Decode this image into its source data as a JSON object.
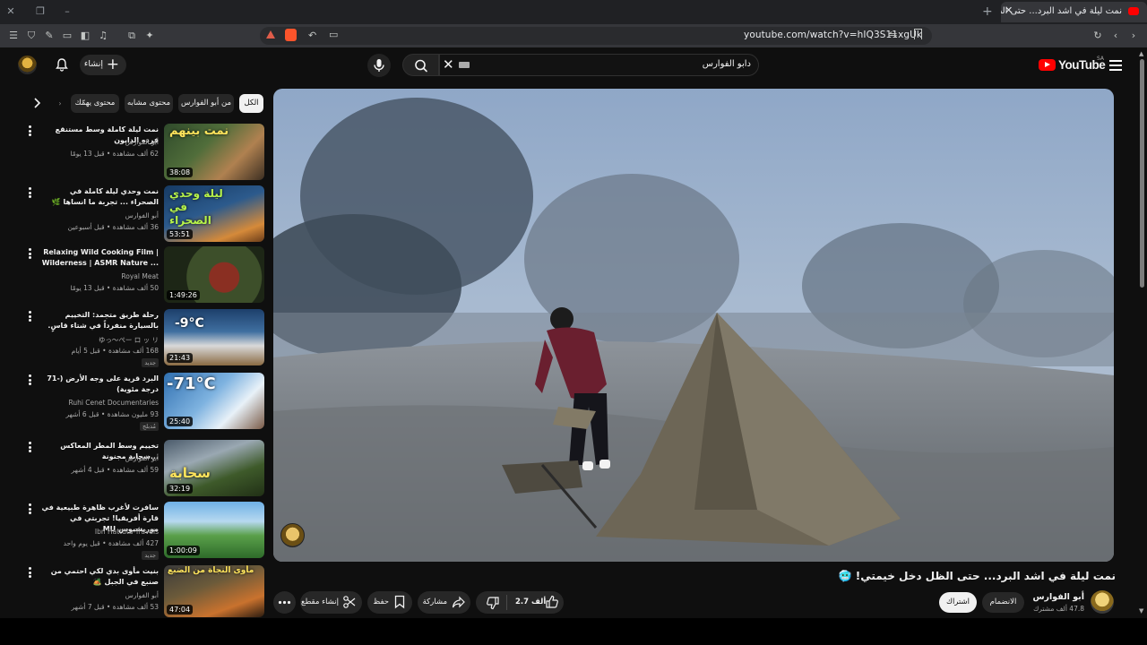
{
  "browser": {
    "tab_title": "نمت ليلة في اشد البرد... حتى الظ",
    "url": "youtube.com/watch?v=hIQ3S11xgUk"
  },
  "header": {
    "logo_text": "YouTube",
    "region": "SA",
    "search_query": "دابو الفوارس",
    "create_label": "إنشاء"
  },
  "chips": [
    {
      "label": "الكل",
      "active": true
    },
    {
      "label": "من أبو الفوارس",
      "active": false
    },
    {
      "label": "محتوى مشابه",
      "active": false
    },
    {
      "label": "محتوى يهمّك",
      "active": false
    }
  ],
  "recommendations": [
    {
      "title": "نمت ليلة كاملة وسط مستنقع فرده الدايون",
      "channel": "أبو الفوارس",
      "meta": "62 ألف مشاهدة • قبل 13 يومًا",
      "duration": "38:08",
      "overlay": "نمت بينهم"
    },
    {
      "title": "نمت وحدي ليلة كاملة في الصحراء ... تجربة ما انساها 🌿",
      "channel": "أبو الفوارس",
      "meta": "36 ألف مشاهدة • قبل أسبوعين",
      "duration": "53:51",
      "overlay": "ليلة وحدي في الصحراء"
    },
    {
      "title": "Relaxing Wild Cooking Film | Wilderness | ASMR Nature ...",
      "channel": "Royal Meat",
      "meta": "50 ألف مشاهدة • قبل 13 يومًا",
      "duration": "1:49:26",
      "overlay": ""
    },
    {
      "title": "رحلة طريق متجمد: التخييم بالسيارة منفرداً في شتاء قاسٍ.",
      "channel": "ゆっ〜ぺー ロ ッ リ",
      "meta": "168 ألف مشاهدة • قبل 5 أيام",
      "duration": "21:43",
      "overlay": "-9°C",
      "badge": "جديد"
    },
    {
      "title": "البرد قرية على وجه الأرض (-71 درجة مئوية)",
      "channel": "Ruhi Cenet Documentaries",
      "meta": "93 مليون مشاهدة • قبل 6 أشهر",
      "duration": "25:40",
      "overlay": "-71°C",
      "badge": "مُدبلج"
    },
    {
      "title": "تخييم وسط المطر المعاكس ...سحابة مجنونة",
      "channel": "أبو الفوارس",
      "meta": "59 ألف مشاهدة • قبل 4 أشهر",
      "duration": "32:19",
      "overlay": "سحابة"
    },
    {
      "title": "سافرت لأغرب ظاهرة طبيعية في قارة أفريقيا! تجربتي في موريشيوس MU",
      "channel": "Ibn Hattuta Travels",
      "meta": "427 ألف مشاهدة • قبل يوم واحد",
      "duration": "1:00:09",
      "overlay": "",
      "badge": "جديد"
    },
    {
      "title": "بنيت مأوى بدي لكي احتمي من صنبع في الجبل 🏕️",
      "channel": "أبو الفوارس",
      "meta": "53 ألف مشاهدة • قبل 7 أشهر",
      "duration": "47:04",
      "overlay": "مأوى النجاة من الضبع"
    }
  ],
  "video": {
    "title": "نمت ليلة في اشد البرد... حتى الظل دخل خيمتي! 🥶"
  },
  "channel": {
    "name": "أبو الفوارس",
    "subs": "47.8 ألف مشترك",
    "join_label": "الانضمام",
    "subscribe_label": "اشتراك"
  },
  "actions": {
    "likes": "2.7 ألف",
    "share": "مشاركة",
    "save": "حفظ",
    "clip": "إنشاء مقطع"
  },
  "colors": {
    "background": "#0f0f0f",
    "accent": "#ff0000",
    "chip_bg": "#272727"
  }
}
